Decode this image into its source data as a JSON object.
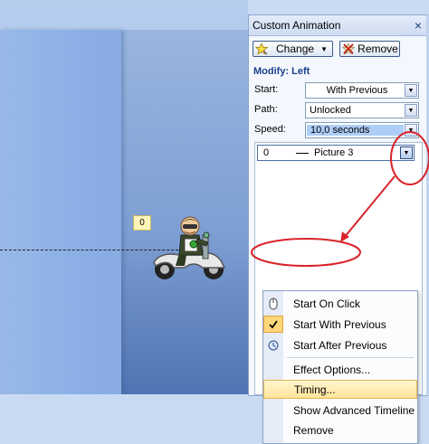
{
  "task_pane": {
    "title": "Custom Animation",
    "close_glyph": "×",
    "change_label": "Change",
    "remove_label": "Remove",
    "modify_label": "Modify: Left",
    "start_label": "Start:",
    "start_value": "With Previous",
    "path_label": "Path:",
    "path_value": "Unlocked",
    "speed_label": "Speed:",
    "speed_value": "10,0 seconds"
  },
  "effect_item": {
    "order": "0",
    "name": "Picture 3"
  },
  "context_menu": {
    "items": [
      {
        "label": "Start On Click",
        "icon": "mouse-icon"
      },
      {
        "label": "Start With Previous",
        "icon": "checkmark-icon",
        "checked": true
      },
      {
        "label": "Start After Previous",
        "icon": "clock-icon"
      },
      {
        "label": "Effect Options...",
        "icon": ""
      },
      {
        "label": "Timing...",
        "icon": "",
        "highlighted": true
      },
      {
        "label": "Show Advanced Timeline",
        "icon": ""
      },
      {
        "label": "Remove",
        "icon": ""
      }
    ]
  },
  "slide": {
    "order_tag": "0"
  },
  "colors": {
    "annotation": "#d9242b",
    "highlight": "#ffe49a",
    "accent": "#1b3f8b"
  }
}
